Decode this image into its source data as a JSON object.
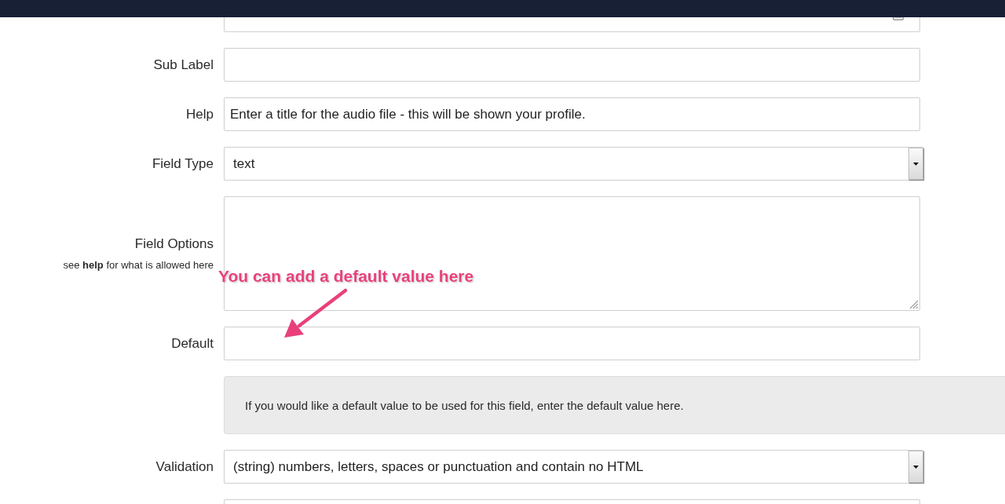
{
  "form": {
    "fields": [
      {
        "kind": "input",
        "trailing_icon": true
      },
      {
        "kind": "input",
        "label": "Sub Label"
      },
      {
        "kind": "input",
        "label": "Help",
        "value": "Enter a title for the audio file - this will be shown your profile."
      },
      {
        "kind": "select",
        "label": "Field Type",
        "value": "text"
      },
      {
        "kind": "textarea",
        "label": "Field Options",
        "note": "see **help** for what is allowed here"
      },
      {
        "kind": "input",
        "label": "Default"
      },
      {
        "kind": "info",
        "text": "If you would like a default value to be used for this field, enter the default value here."
      },
      {
        "kind": "select",
        "label": "Validation",
        "value": "(string) numbers, letters, spaces or punctuation and contain no HTML"
      },
      {
        "kind": "input"
      }
    ]
  },
  "annotation": {
    "text": "You can add a default value here"
  }
}
